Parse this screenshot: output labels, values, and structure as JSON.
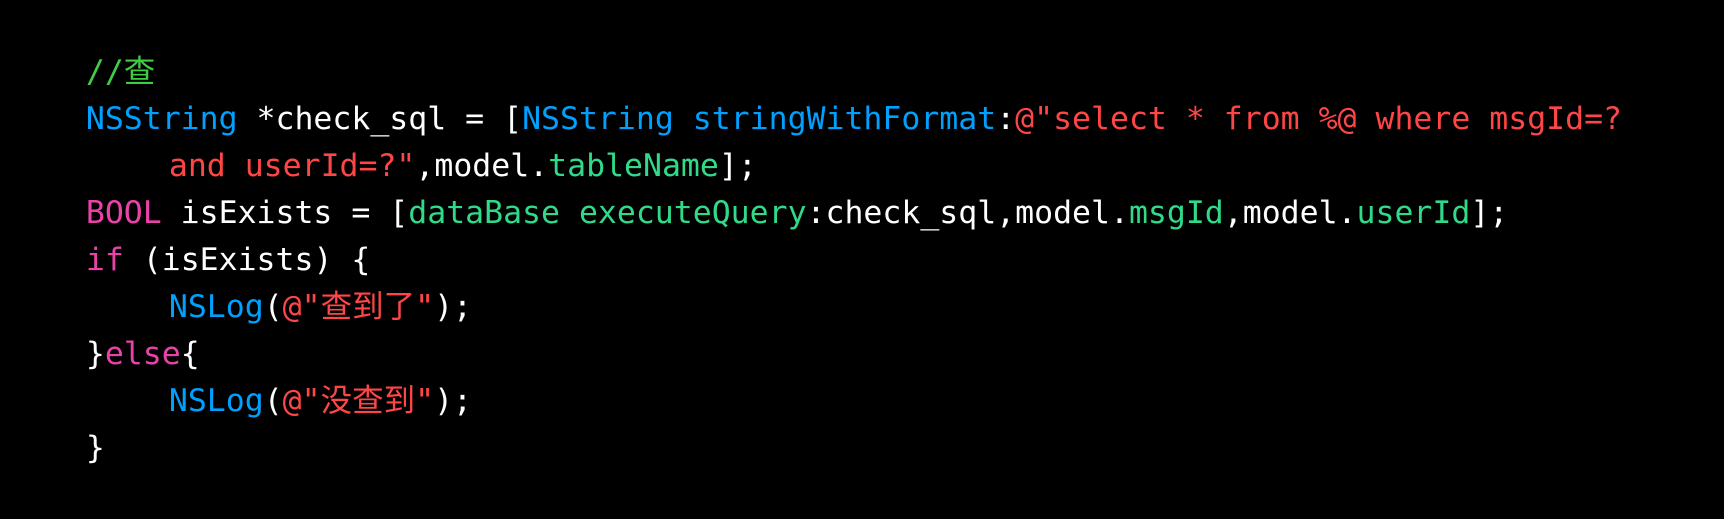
{
  "editor": {
    "lines": [
      [
        {
          "t": "//查",
          "k": "comment"
        }
      ],
      [
        {
          "t": "NSString",
          "k": "class"
        },
        {
          "t": " *check_sql = [",
          "k": "plain"
        },
        {
          "t": "NSString",
          "k": "class"
        },
        {
          "t": " ",
          "k": "plain"
        },
        {
          "t": "stringWithFormat",
          "k": "method"
        },
        {
          "t": ":",
          "k": "plain"
        },
        {
          "t": "@\"select * from %@ where msgId=?",
          "k": "string"
        }
      ],
      [
        {
          "t": "and userId=?\"",
          "k": "string"
        },
        {
          "t": ",model.",
          "k": "plain"
        },
        {
          "t": "tableName",
          "k": "prop"
        },
        {
          "t": "];",
          "k": "plain"
        }
      ],
      [
        {
          "t": "BOOL",
          "k": "keyword"
        },
        {
          "t": " isExists = [",
          "k": "plain"
        },
        {
          "t": "dataBase",
          "k": "prop"
        },
        {
          "t": " ",
          "k": "plain"
        },
        {
          "t": "executeQuery",
          "k": "prop"
        },
        {
          "t": ":check_sql,model.",
          "k": "plain"
        },
        {
          "t": "msgId",
          "k": "prop"
        },
        {
          "t": ",model.",
          "k": "plain"
        },
        {
          "t": "userId",
          "k": "prop"
        },
        {
          "t": "];",
          "k": "plain"
        }
      ],
      [
        {
          "t": "if",
          "k": "keyword"
        },
        {
          "t": " (isExists) {",
          "k": "plain"
        }
      ],
      [
        {
          "t": "NSLog",
          "k": "class"
        },
        {
          "t": "(",
          "k": "plain"
        },
        {
          "t": "@\"查到了\"",
          "k": "string"
        },
        {
          "t": ");",
          "k": "plain"
        }
      ],
      [
        {
          "t": "}",
          "k": "plain"
        },
        {
          "t": "else",
          "k": "keyword"
        },
        {
          "t": "{",
          "k": "plain"
        }
      ],
      [
        {
          "t": "NSLog",
          "k": "class"
        },
        {
          "t": "(",
          "k": "plain"
        },
        {
          "t": "@\"没查到\"",
          "k": "string"
        },
        {
          "t": ");",
          "k": "plain"
        }
      ],
      [
        {
          "t": "}",
          "k": "plain"
        }
      ]
    ]
  },
  "colors": {
    "background": "#000000",
    "comment": "#41CC45",
    "class": "#00A0FF",
    "string": "#FF4647",
    "keyword": "#E942A8",
    "property": "#2FDA88",
    "plain": "#FFFFFF"
  }
}
